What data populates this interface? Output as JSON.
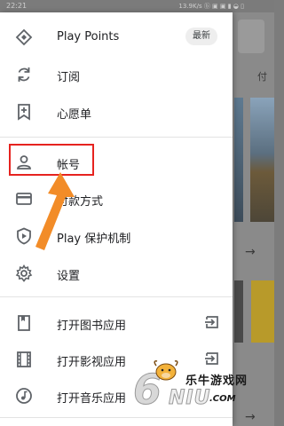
{
  "status_bar": {
    "time": "22:21",
    "right": "13.9K/s ⓑ ▣ ▣ ▮ ◒ ▯"
  },
  "background": {
    "tab_partial": "付"
  },
  "drawer": {
    "items": [
      {
        "icon": "diamond-icon",
        "label": "Play Points",
        "badge": "最新"
      },
      {
        "icon": "refresh-icon",
        "label": "订阅"
      },
      {
        "icon": "bookmark-add-icon",
        "label": "心愿单"
      },
      {
        "icon": "person-icon",
        "label": "帐号"
      },
      {
        "icon": "credit-card-icon",
        "label": "付款方式"
      },
      {
        "icon": "play-shield-icon",
        "label": "Play 保护机制"
      },
      {
        "icon": "gear-icon",
        "label": "设置"
      },
      {
        "icon": "book-icon",
        "label": "打开图书应用"
      },
      {
        "icon": "film-icon",
        "label": "打开影视应用"
      },
      {
        "icon": "music-note-icon",
        "label": "打开音乐应用"
      }
    ],
    "open_app_icon": "open-external-icon"
  },
  "annotation": {
    "highlight_color": "#e6231f",
    "arrow_color": "#f28c28"
  },
  "watermark": {
    "cn": "乐牛游戏网",
    "logo": "6",
    "logo2": "NIU",
    "com": ".COM"
  }
}
